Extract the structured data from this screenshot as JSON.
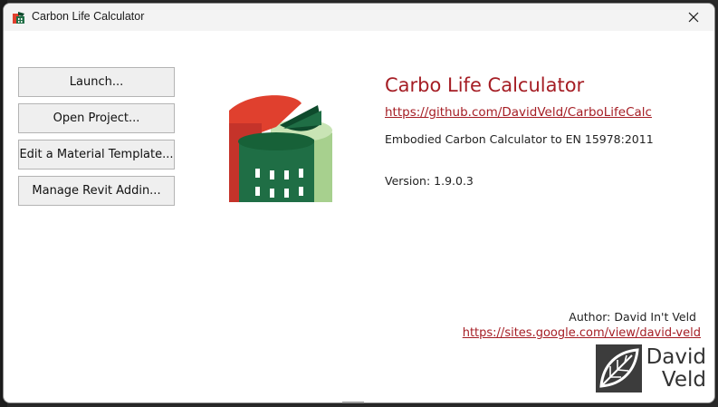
{
  "window": {
    "title": "Carbon Life Calculator",
    "close_icon": "close-icon"
  },
  "menu": {
    "buttons": [
      {
        "label": "Launch..."
      },
      {
        "label": "Open Project..."
      },
      {
        "label": "Edit a Material Template..."
      },
      {
        "label": "Manage Revit Addin..."
      }
    ]
  },
  "about": {
    "app_name": "Carbo Life Calculator",
    "repo_url": "https://github.com/DavidVeld/CarboLifeCalc",
    "description": "Embodied Carbon Calculator to EN 15978:2011",
    "version": "Version: 1.9.0.3"
  },
  "author": {
    "label": "Author: David In't Veld",
    "url": "https://sites.google.com/view/david-veld",
    "brand_line1": "David",
    "brand_line2": "Veld"
  },
  "colors": {
    "accent": "#a51d24",
    "logo_red": "#e0402e",
    "logo_green": "#1f6e45",
    "logo_dark_green": "#0e4a2c",
    "logo_light_green": "#a7d08e"
  }
}
